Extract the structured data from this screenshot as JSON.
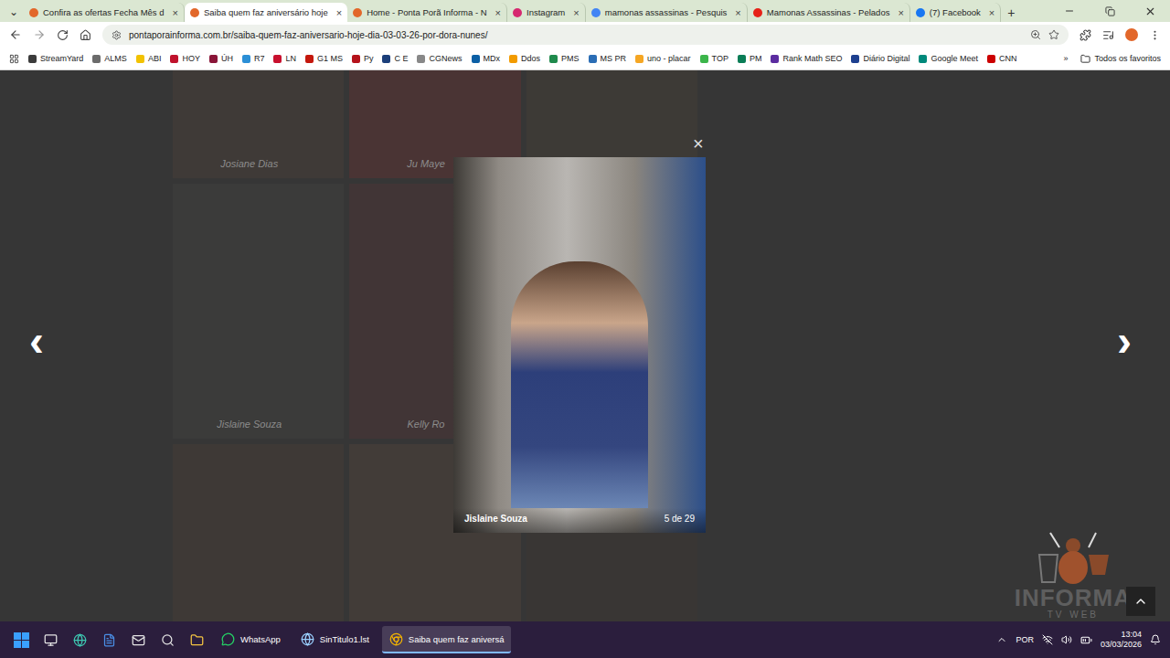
{
  "browser": {
    "tabs_menu": "⌄",
    "tabs": [
      {
        "label": "Confira as ofertas Fecha Mês d",
        "selected": false,
        "color": "#e2672a"
      },
      {
        "label": "Saiba quem faz aniversário hoje",
        "selected": true,
        "color": "#e2672a"
      },
      {
        "label": "Home - Ponta Porã Informa - N",
        "selected": false,
        "color": "#e2672a"
      },
      {
        "label": "Instagram",
        "selected": false,
        "color": "#d6286f"
      },
      {
        "label": "mamonas assassinas - Pesquis",
        "selected": false,
        "color": "#4285f4"
      },
      {
        "label": "Mamonas Assassinas - Pelados",
        "selected": false,
        "color": "#e62117"
      },
      {
        "label": "(7) Facebook",
        "selected": false,
        "color": "#1877f2"
      }
    ],
    "tab_close": "×",
    "new_tab": "+",
    "address": "pontaporainforma.com.br/saiba-quem-faz-aniversario-hoje-dia-03-03-26-por-dora-nunes/",
    "bookmarks": [
      {
        "label": "StreamYard",
        "color": "#3b3b3b"
      },
      {
        "label": "ALMS",
        "color": "#6b6b6b"
      },
      {
        "label": "ABI",
        "color": "#f2c200"
      },
      {
        "label": "HOY",
        "color": "#c0122c"
      },
      {
        "label": "ÚH",
        "color": "#8a1538"
      },
      {
        "label": "R7",
        "color": "#2b8fd6"
      },
      {
        "label": "LN",
        "color": "#c8102e"
      },
      {
        "label": "G1 MS",
        "color": "#c4170c"
      },
      {
        "label": "Py",
        "color": "#b5121b"
      },
      {
        "label": "C E",
        "color": "#1c3f7a"
      },
      {
        "label": "CGNews",
        "color": "#888888"
      },
      {
        "label": "MDx",
        "color": "#0b5fa5"
      },
      {
        "label": "Ddos",
        "color": "#f29b00"
      },
      {
        "label": "PMS",
        "color": "#1f8a4c"
      },
      {
        "label": "MS PR",
        "color": "#2a6db5"
      },
      {
        "label": "uno - placar",
        "color": "#f5a623"
      },
      {
        "label": "TOP",
        "color": "#3bb54a"
      },
      {
        "label": "PM",
        "color": "#0a7d56"
      },
      {
        "label": "Rank Math SEO",
        "color": "#5b2ca0"
      },
      {
        "label": "Diário Digital",
        "color": "#1d3f8f"
      },
      {
        "label": "Google Meet",
        "color": "#00897b"
      },
      {
        "label": "CNN",
        "color": "#cc0000"
      }
    ],
    "more_bookmarks": "»",
    "all_bookmarks": "Todos os favoritos"
  },
  "gallery": {
    "tiles": [
      {
        "caption": "Josiane Dias"
      },
      {
        "caption": "Ju Maye"
      },
      {},
      {
        "caption": "Jislaine Souza"
      },
      {
        "caption": "Kelly Ro"
      },
      {},
      {},
      {},
      {}
    ]
  },
  "lightbox": {
    "close": "×",
    "prev": "‹",
    "next": "›",
    "caption": "Jislaine Souza",
    "counter": "5 de 29"
  },
  "watermark": {
    "title": "INFORMA",
    "subtitle": "TV WEB"
  },
  "taskbar": {
    "items": [
      {
        "label": "WhatsApp",
        "selected": false
      },
      {
        "label": "SinTitulo1.lst",
        "selected": false
      },
      {
        "label": "Saiba quem faz aniversá",
        "selected": true
      }
    ],
    "language": "POR",
    "time": "13:04",
    "date": "03/03/2026"
  }
}
